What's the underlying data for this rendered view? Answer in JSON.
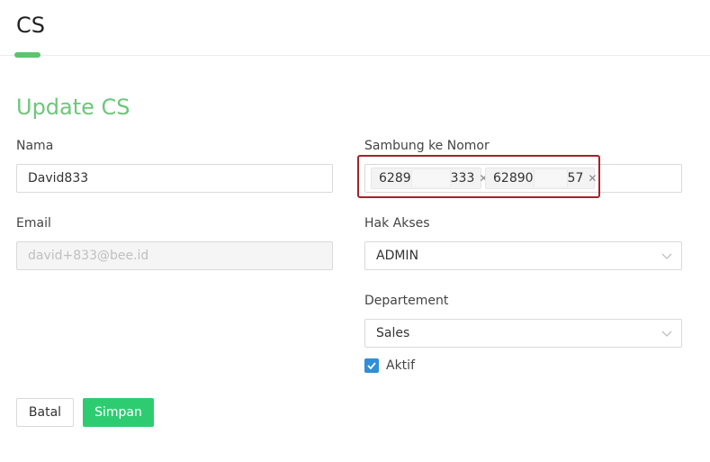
{
  "header": {
    "title": "CS"
  },
  "form": {
    "title": "Update CS",
    "nama": {
      "label": "Nama",
      "value": "David833"
    },
    "email": {
      "label": "Email",
      "value": "david+833@bee.id"
    },
    "sambung": {
      "label": "Sambung ke Nomor",
      "tags": [
        {
          "prefix": "6289",
          "suffix": "333"
        },
        {
          "prefix": "62890",
          "suffix": "57"
        }
      ]
    },
    "hak_akses": {
      "label": "Hak Akses",
      "value": "ADMIN"
    },
    "departement": {
      "label": "Departement",
      "value": "Sales"
    },
    "aktif": {
      "label": "Aktif",
      "checked": true
    }
  },
  "buttons": {
    "cancel": "Batal",
    "save": "Simpan"
  },
  "colors": {
    "accent": "#6cc77a",
    "save": "#2ecc71",
    "checkbox": "#2f8fd8",
    "highlight": "#a4232a"
  }
}
